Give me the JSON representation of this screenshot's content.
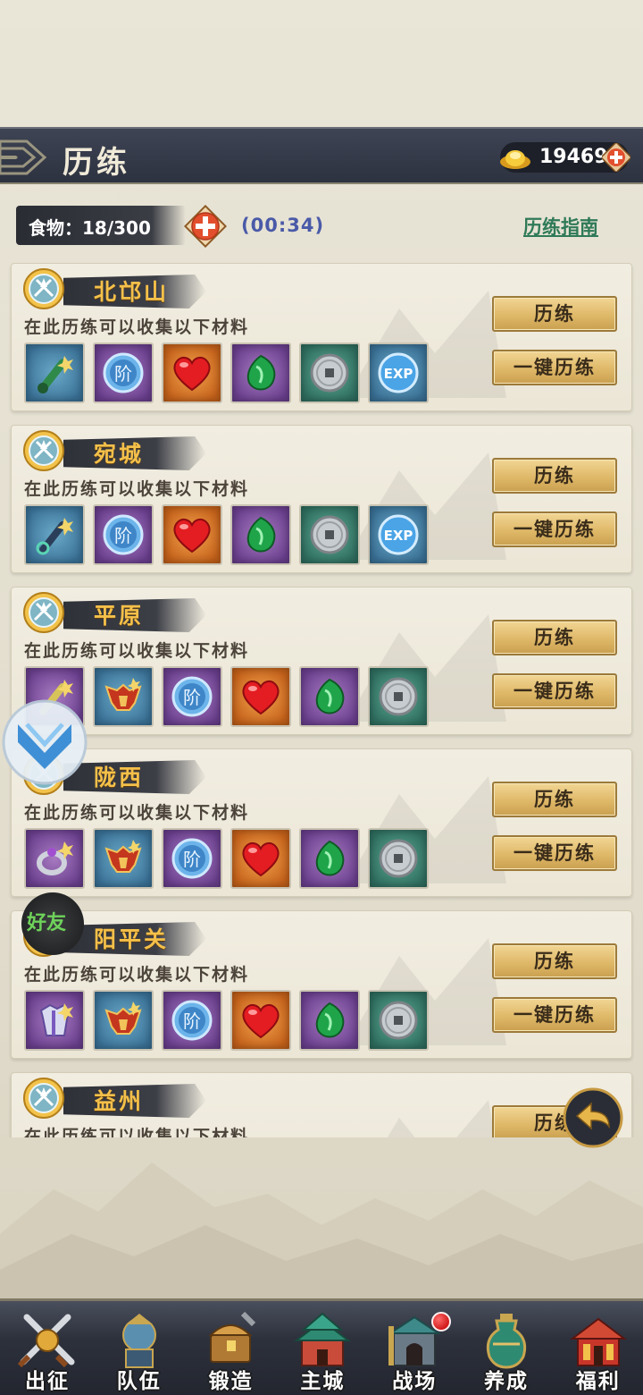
{
  "header": {
    "title": "历练",
    "gold": "19469"
  },
  "food": {
    "label": "食物：18/300",
    "timer": "(00:34)"
  },
  "guide_link": "历练指南",
  "collect_text": "在此历练可以收集以下材料",
  "buttons": {
    "train": "历练",
    "quick_train": "一键历练"
  },
  "locations": [
    {
      "name": "北邙山",
      "materials": [
        "green-weapon-fragment",
        "rank-orb",
        "heart",
        "green-jade",
        "silver-coin",
        "exp-orb"
      ]
    },
    {
      "name": "宛城",
      "materials": [
        "blue-weapon-fragment",
        "rank-orb",
        "heart",
        "green-jade",
        "silver-coin",
        "exp-orb"
      ]
    },
    {
      "name": "平原",
      "materials": [
        "purple-weapon-fragment",
        "armor-fragment",
        "rank-orb",
        "heart",
        "green-jade",
        "silver-coin"
      ]
    },
    {
      "name": "陇西",
      "materials": [
        "ring-fragment",
        "armor-fragment",
        "rank-orb",
        "heart",
        "green-jade",
        "silver-coin"
      ]
    },
    {
      "name": "阳平关",
      "materials": [
        "robe-fragment",
        "armor-fragment",
        "rank-orb",
        "heart",
        "green-jade",
        "silver-coin"
      ]
    },
    {
      "name": "益州",
      "materials": []
    }
  ],
  "friends_label": "好友",
  "nav": [
    {
      "label": "出征",
      "icon": "crossed-swords-icon"
    },
    {
      "label": "队伍",
      "icon": "warrior-icon"
    },
    {
      "label": "锻造",
      "icon": "forge-chest-icon"
    },
    {
      "label": "主城",
      "icon": "castle-icon"
    },
    {
      "label": "战场",
      "icon": "battlefield-gate-icon",
      "badge": true
    },
    {
      "label": "养成",
      "icon": "urn-icon"
    },
    {
      "label": "福利",
      "icon": "gift-pavilion-icon"
    }
  ],
  "colors": {
    "header_bg": "#2d3240",
    "location_name": "#f4c04a",
    "button_gold": "#dfb868",
    "guide_link": "#2f7a58",
    "timer": "#4a5aa8",
    "friends_label": "#6fd35b"
  }
}
